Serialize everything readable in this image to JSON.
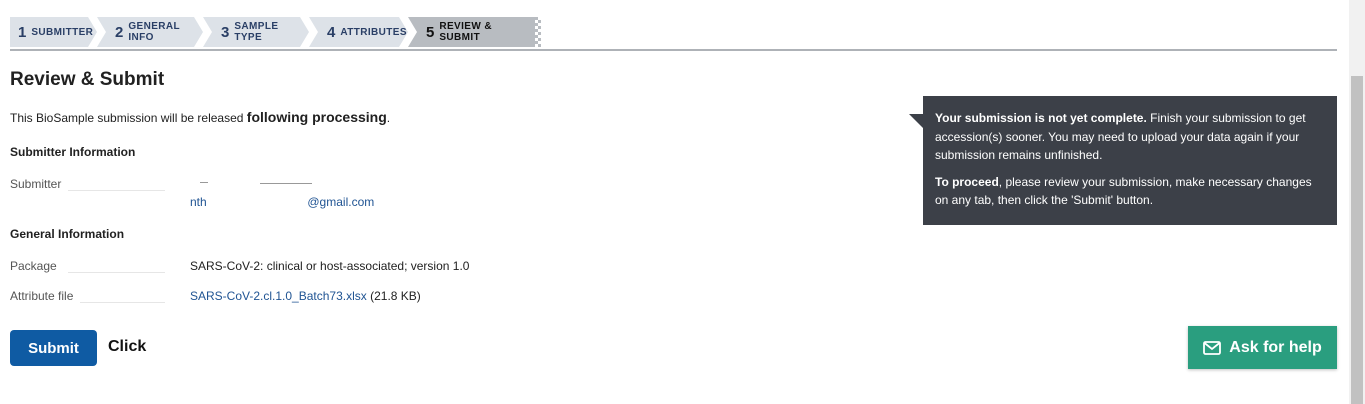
{
  "wizard": {
    "steps": [
      {
        "num": "1",
        "label": "Submitter"
      },
      {
        "num": "2",
        "label": "General Info"
      },
      {
        "num": "3",
        "label": "Sample Type"
      },
      {
        "num": "4",
        "label": "Attributes"
      },
      {
        "num": "5",
        "label": "Review & Submit"
      }
    ],
    "active_step": 5
  },
  "page": {
    "title": "Review & Submit",
    "release_prefix": "This BioSample submission will be released",
    "release_when": "following processing",
    "release_suffix": "."
  },
  "submitter_section": {
    "heading": "Submitter Information",
    "submitter_label": "Submitter",
    "email_partial_left": "nth",
    "email_partial_right": "@gmail.com"
  },
  "general_section": {
    "heading": "General Information",
    "package_label": "Package",
    "package_value": "SARS-CoV-2: clinical or host-associated; version 1.0",
    "attribute_file_label": "Attribute file",
    "attribute_file_name": "SARS-CoV-2.cl.1.0_Batch73.xlsx",
    "attribute_file_size": "(21.8 KB)"
  },
  "actions": {
    "submit_label": "Submit",
    "click_note": "Click",
    "help_label": "Ask for help"
  },
  "notice": {
    "line1_bold": "Your submission is not yet complete.",
    "line1_rest": "Finish your submission to get accession(s) sooner. You may need to upload your data again if your submission remains unfinished.",
    "line2_bold": "To proceed",
    "line2_rest": ", please review your submission, make necessary changes on any tab, then click the 'Submit' button."
  },
  "colors": {
    "primary_button": "#0f5ba3",
    "help_button": "#2a9e7f",
    "notice_bg": "#3c4048",
    "link": "#205493"
  }
}
